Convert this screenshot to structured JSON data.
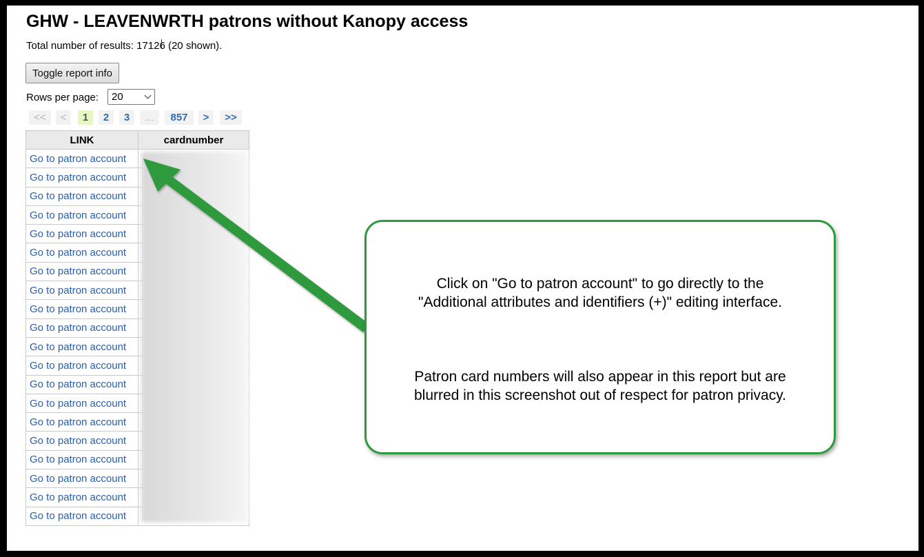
{
  "title": "GHW - LEAVENWRTH patrons without Kanopy access",
  "total": {
    "label": "Total number of results:",
    "count": "17126",
    "shown": "(20 shown)."
  },
  "toggle_button": "Toggle report info",
  "rows_per_page": {
    "label": "Rows per page:",
    "value": "20"
  },
  "pagination": {
    "first": "<<",
    "prev": "<",
    "pages": [
      "1",
      "2",
      "3"
    ],
    "ellipsis": "...",
    "last_page": "857",
    "next": ">",
    "last": ">>",
    "current": "1"
  },
  "table": {
    "headers": [
      "LINK",
      "cardnumber"
    ],
    "link_text": "Go to patron account",
    "row_count": 20
  },
  "callout": {
    "line1": "Click on \"Go to patron account\" to go directly to the",
    "line2": "\"Additional attributes and identifiers (+)\" editing interface.",
    "line3": "Patron card numbers will also appear in this report but are",
    "line4": "blurred in this screenshot out of respect for patron privacy."
  },
  "colors": {
    "link": "#2a5ea8",
    "callout_border": "#2f9a3d",
    "arrow": "#2f9a3d",
    "current_page_bg": "#e6f9c4"
  }
}
